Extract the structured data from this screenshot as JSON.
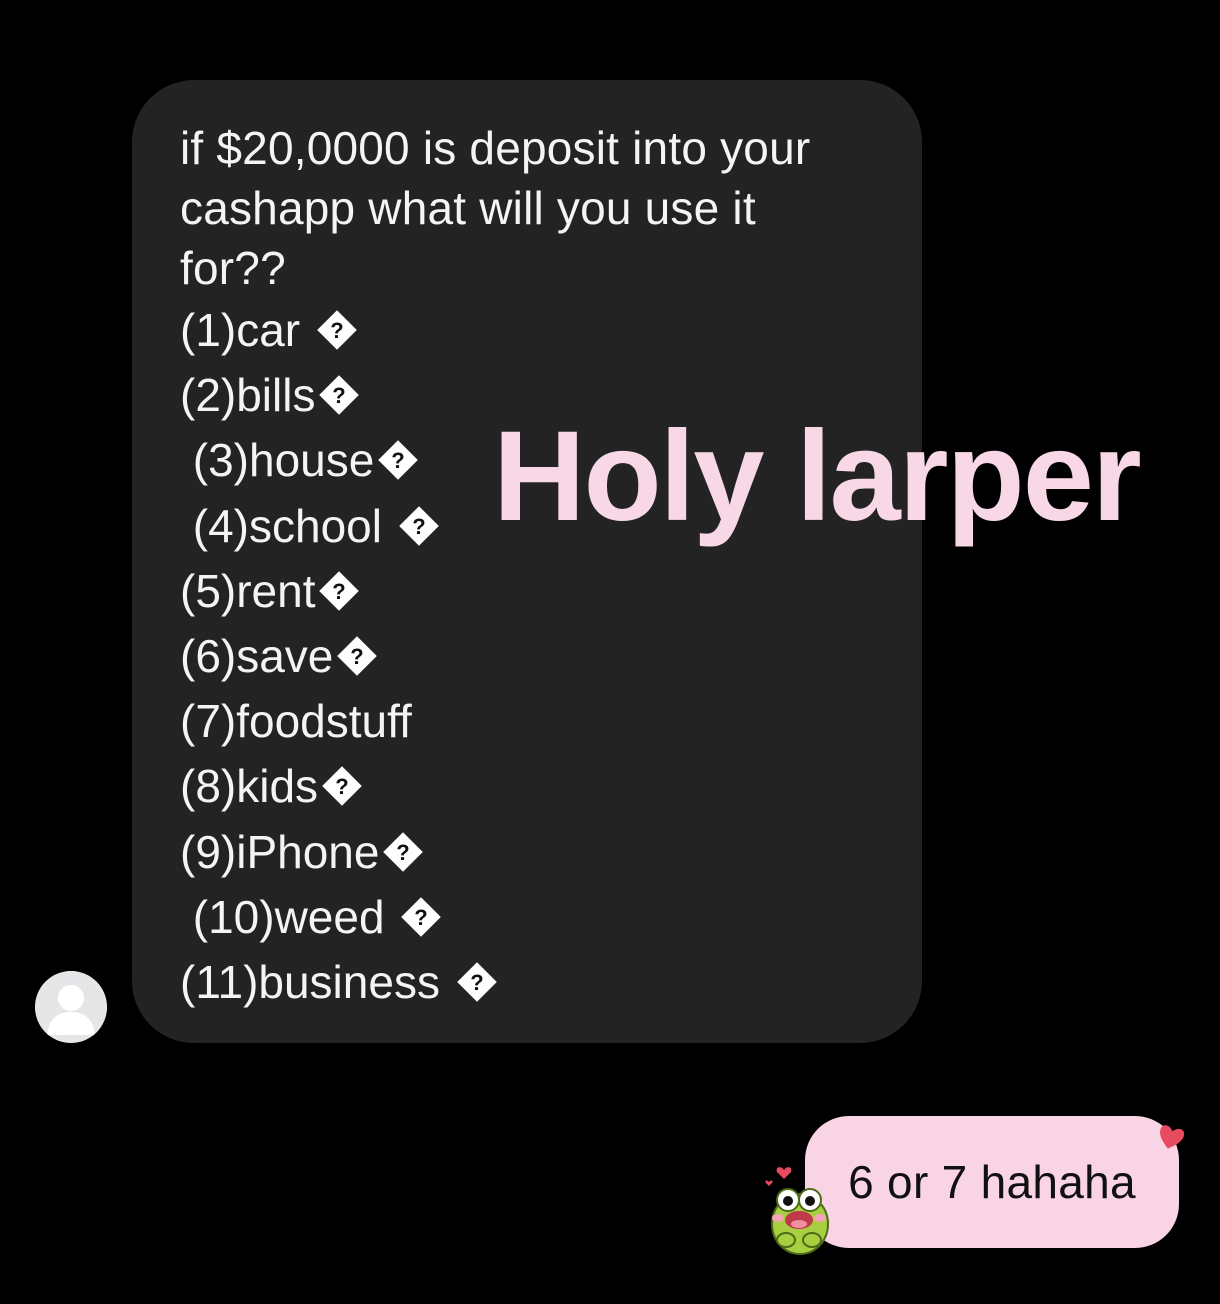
{
  "incoming_message": {
    "lines": [
      "if $20,0000 is deposit into your",
      "cashapp what will you use it",
      "for??"
    ],
    "list": [
      {
        "text": "(1)car ",
        "has_glyph": true
      },
      {
        "text": "(2)bills",
        "has_glyph": true
      },
      {
        "text": " (3)house",
        "has_glyph": true
      },
      {
        "text": " (4)school ",
        "has_glyph": true
      },
      {
        "text": "(5)rent",
        "has_glyph": true
      },
      {
        "text": "(6)save",
        "has_glyph": true
      },
      {
        "text": "(7)foodstuff",
        "has_glyph": false
      },
      {
        "text": "(8)kids",
        "has_glyph": true
      },
      {
        "text": "(9)iPhone",
        "has_glyph": true
      },
      {
        "text": " (10)weed ",
        "has_glyph": true
      },
      {
        "text": "(11)business ",
        "has_glyph": true
      }
    ],
    "bubble_color": "#232323",
    "text_color": "#f4f4f4"
  },
  "overlay": {
    "caption": "Holy larper",
    "color": "#f8d8e6"
  },
  "outgoing_message": {
    "text": "6 or 7 hahaha",
    "bubble_color": "#f9d4e5",
    "text_color": "#111111"
  },
  "icons": {
    "sender_avatar": "default-user-avatar-icon",
    "unknown_glyph": "replacement-character-icon",
    "heart": "heart-icon",
    "sticker": "frog-sticker-icon"
  }
}
